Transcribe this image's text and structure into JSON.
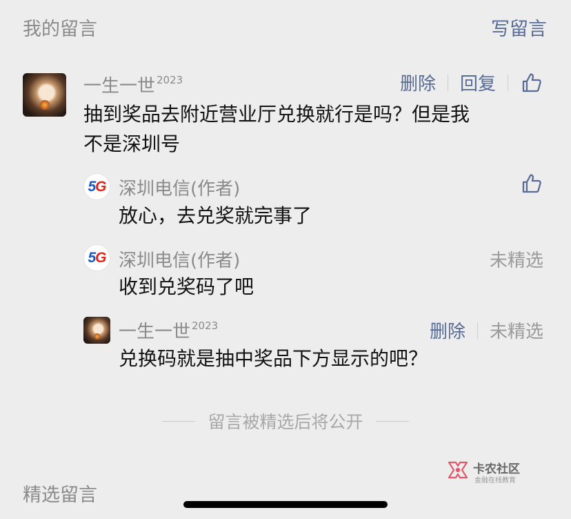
{
  "header": {
    "title": "我的留言",
    "write_label": "写留言"
  },
  "comment": {
    "author": "一生一世",
    "author_tag": "2023",
    "avatar_icon": "rabbit-avatar",
    "text_line1": "抽到奖品去附近营业厅兑换就行是吗？但是我",
    "text_line2": "不是深圳号",
    "delete_label": "删除",
    "reply_label": "回复",
    "like_icon": "thumbs-up-icon"
  },
  "replies": [
    {
      "author": "深圳电信(作者)",
      "avatar_icon": "5g-avatar",
      "avatar_text_5": "5",
      "avatar_text_g": "G",
      "text": "放心，去兑奖就完事了",
      "like_icon": "thumbs-up-icon"
    },
    {
      "author": "深圳电信(作者)",
      "avatar_icon": "5g-avatar",
      "avatar_text_5": "5",
      "avatar_text_g": "G",
      "text": "收到兑奖码了吧",
      "status_label": "未精选"
    },
    {
      "author": "一生一世",
      "author_tag": "2023",
      "avatar_icon": "rabbit-avatar",
      "text": "兑换码就是抽中奖品下方显示的吧？",
      "delete_label": "删除",
      "status_label": "未精选"
    }
  ],
  "notice": "留言被精选后将公开",
  "watermark": {
    "title": "卡农社区",
    "subtitle": "金融在线教育"
  },
  "section_title": "精选留言",
  "colors": {
    "link": "#576b95",
    "muted": "#9a9a9a",
    "background": "#ededed"
  }
}
